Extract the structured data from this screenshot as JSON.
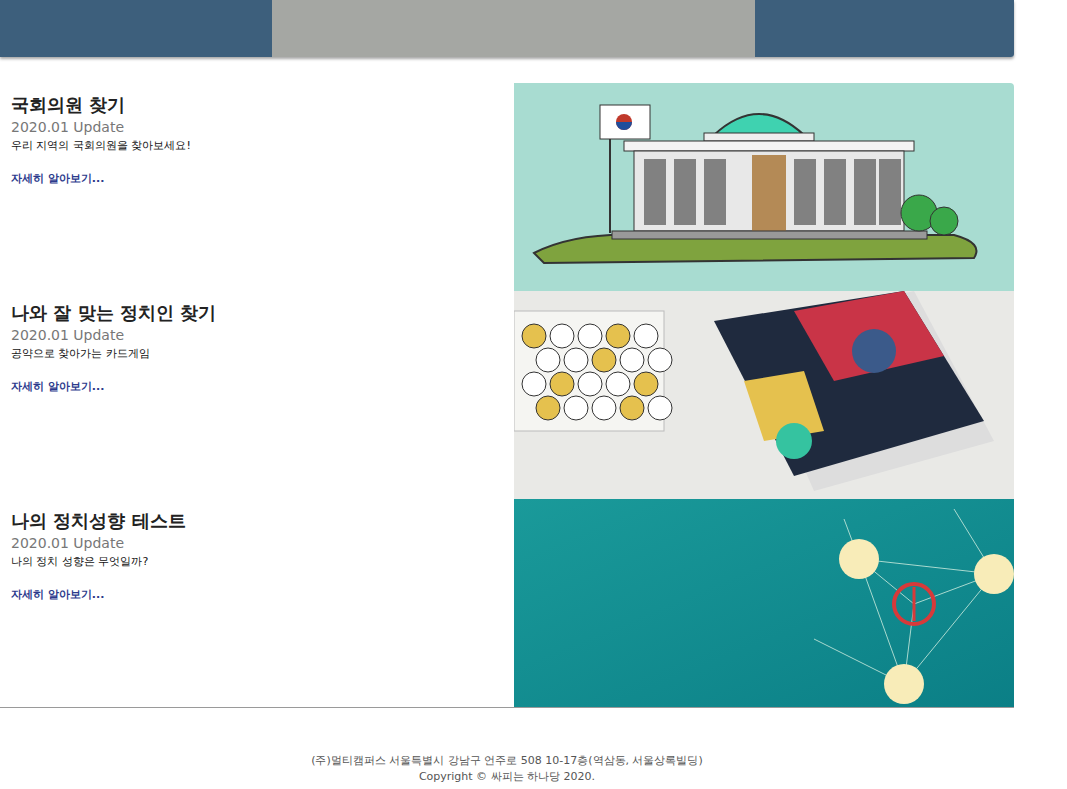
{
  "items": [
    {
      "kind": "assembly",
      "title": "국회의원 찾기",
      "updated": "2020.01 Update",
      "description": "우리 지역의 국회의원을 찾아보세요!",
      "link": "자세히 알아보기..."
    },
    {
      "kind": "cards",
      "title": "나와 잘 맞는 정치인 찾기",
      "updated": "2020.01 Update",
      "description": "공약으로 찾아가는 카드게임",
      "link": "자세히 알아보기..."
    },
    {
      "kind": "network",
      "title": "나의 정치성향 테스트",
      "updated": "2020.01 Update",
      "description": "나의 정치 성향은 무엇일까?",
      "link": "자세히 알아보기..."
    }
  ],
  "footer": {
    "address": "(주)멀티캠퍼스 서울특별시 강남구 언주로 508 10-17층(역삼동, 서울상록빌딩)",
    "copyright": "Copyright © 싸피는 하나당 2020."
  }
}
